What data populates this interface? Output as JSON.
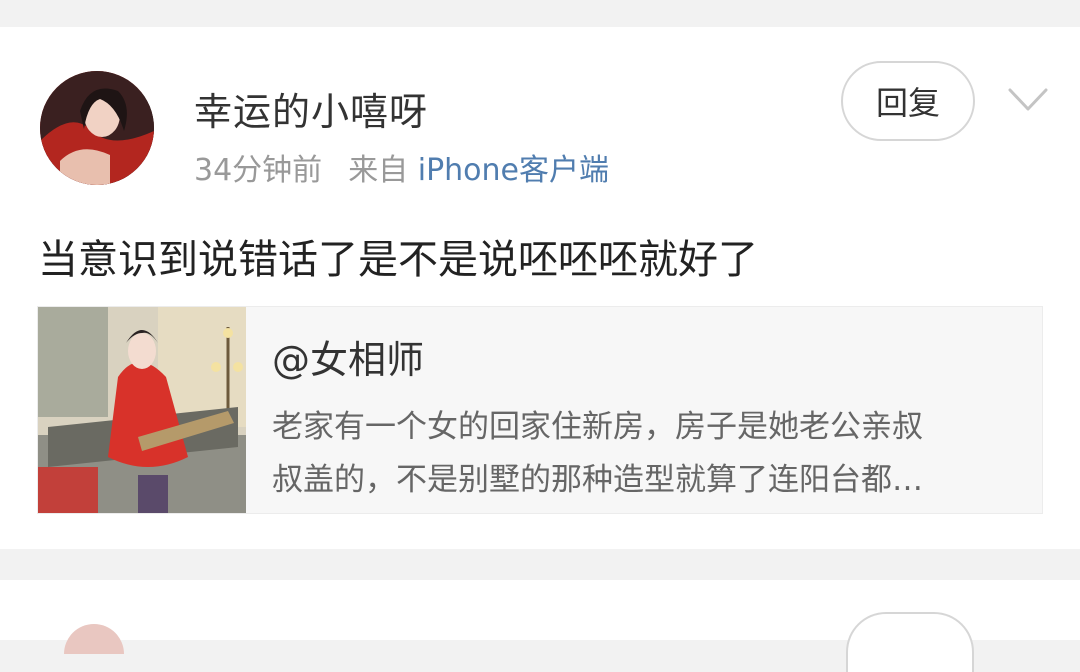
{
  "post": {
    "username": "幸运的小嘻呀",
    "time": "34分钟前",
    "from_label": "来自",
    "client": "iPhone客户端",
    "reply_label": "回复",
    "content": "当意识到说错话了是不是说呸呸呸就好了",
    "repost": {
      "author": "@女相师",
      "text_line1": "老家有一个女的回家住新房，房子是她老公亲叔",
      "text_line2": "叔盖的，不是别墅的那种造型就算了连阳台都…"
    }
  },
  "icons": {
    "more": "chevron-down-icon"
  },
  "colors": {
    "background": "#f2f2f2",
    "link": "#507daf",
    "meta": "#999999",
    "text": "#222222"
  }
}
